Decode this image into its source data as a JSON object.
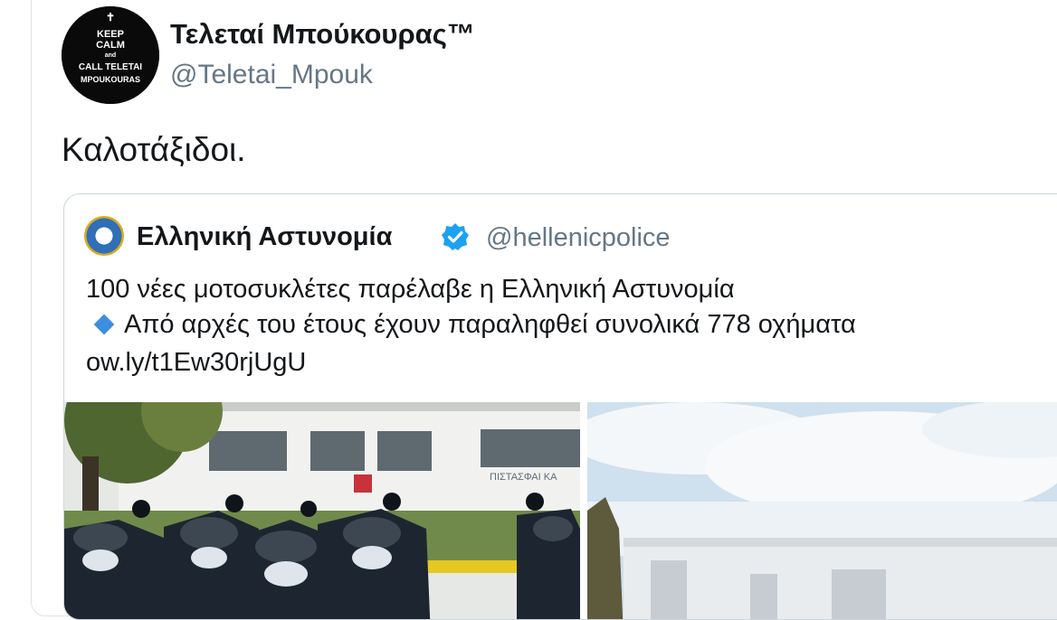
{
  "tweet": {
    "author_name": "Τελεταί Μπούκουρας™",
    "author_handle": "@Teletai_Mpouk",
    "avatar_text": [
      "KEEP",
      "CALM",
      "and",
      "CALL TELETAI",
      "MPOUKOURAS"
    ],
    "text": "Καλοτάξιδοι."
  },
  "quoted_tweet": {
    "author_name": "Ελληνική Αστυνομία",
    "author_handle": "@hellenicpolice",
    "line1": "100 νέες μοτοσυκλέτες παρέλαβε η Ελληνική Αστυνομία",
    "line2": "Από αρχές του έτους έχουν παραληφθεί συνολικά 778 οχήματα",
    "link": "ow.ly/t1Ew30rjUgU",
    "sign_text": "ΠΙΣΤΑΣΦΑΙ ΚΑ"
  },
  "colors": {
    "verified": "#1da1f2",
    "bullet_diamond": "#3b8ee0",
    "handle_gray": "#657786"
  }
}
